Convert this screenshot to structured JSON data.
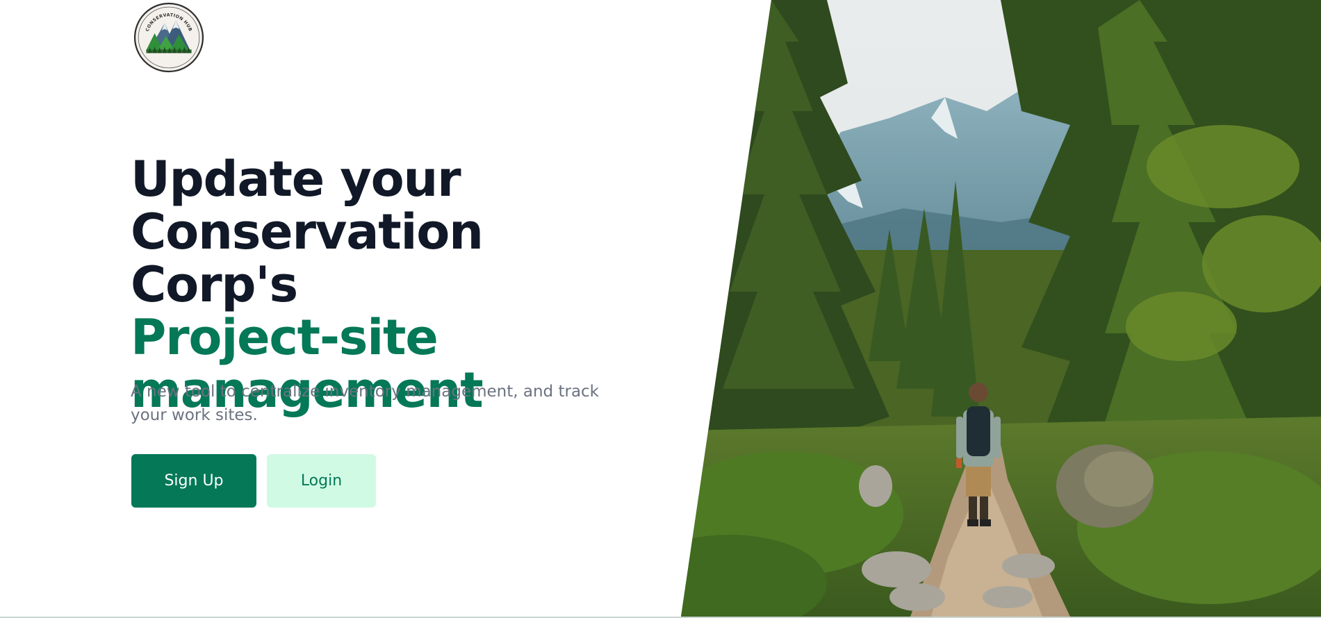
{
  "brand": {
    "logo_text": "CONSERVATION HUB",
    "logo_icon": "mountain-forest-logo"
  },
  "hero": {
    "headline_line1": "Update your",
    "headline_line2": "Conservation Corp's",
    "headline_highlight1": "Project-site",
    "headline_highlight2": "management",
    "subtitle": "A new tool to centralize inventory management, and track your work sites.",
    "image_subject": "hiker walking on a forest trail toward mountains"
  },
  "actions": {
    "signup_label": "Sign Up",
    "login_label": "Login"
  },
  "colors": {
    "heading_dark": "#111827",
    "accent_green": "#047857",
    "accent_light": "#d1fae5",
    "body_text": "#6b7280"
  }
}
